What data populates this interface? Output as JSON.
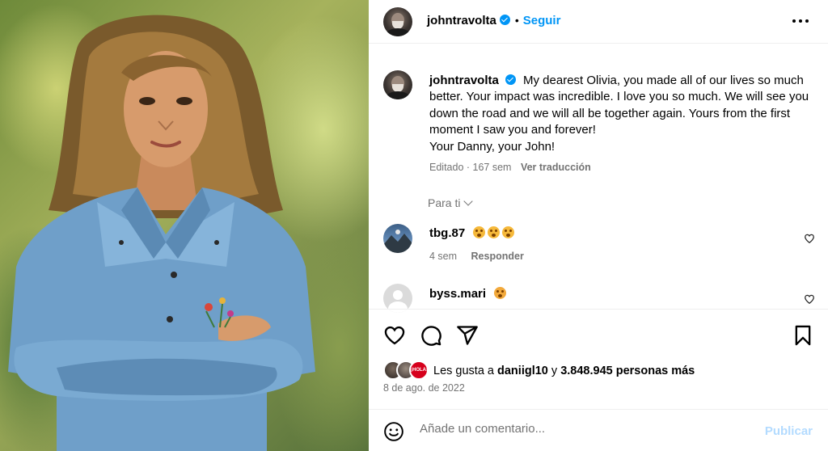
{
  "post": {
    "username": "johntravolta",
    "follow_label": "Seguir",
    "separator": "•",
    "caption": "My dearest Olivia, you made all of our lives so much better. Your impact was incredible. I love you so much. We will see you down the road and we will all be together again. Yours from the first moment I saw you and forever!",
    "caption_signoff": "Your Danny, your John!",
    "edited_label": "Editado · 167 sem",
    "translate_label": "Ver traducción"
  },
  "comments_filter": "Para ti",
  "comments": [
    {
      "username": "tbg.87",
      "time": "4 sem",
      "reply_label": "Responder"
    },
    {
      "username": "byss.mari"
    }
  ],
  "likes": {
    "prefix": "Les gusta a",
    "first_user": "daniigl10",
    "connector": "y",
    "others": "3.848.945 personas más",
    "badge_text": "¡HOLA!"
  },
  "date": "8 de ago. de 2022",
  "add_comment": {
    "placeholder": "Añade un comentario...",
    "post_label": "Publicar"
  },
  "colors": {
    "link": "#0095f6",
    "muted": "#737373",
    "post_disabled": "#b3dbff",
    "badge": "#d6001c"
  },
  "icons": [
    "verified-badge-icon",
    "more-options-icon",
    "chevron-down-icon",
    "heart-icon",
    "comment-icon",
    "share-icon",
    "bookmark-icon",
    "emoji-icon"
  ]
}
